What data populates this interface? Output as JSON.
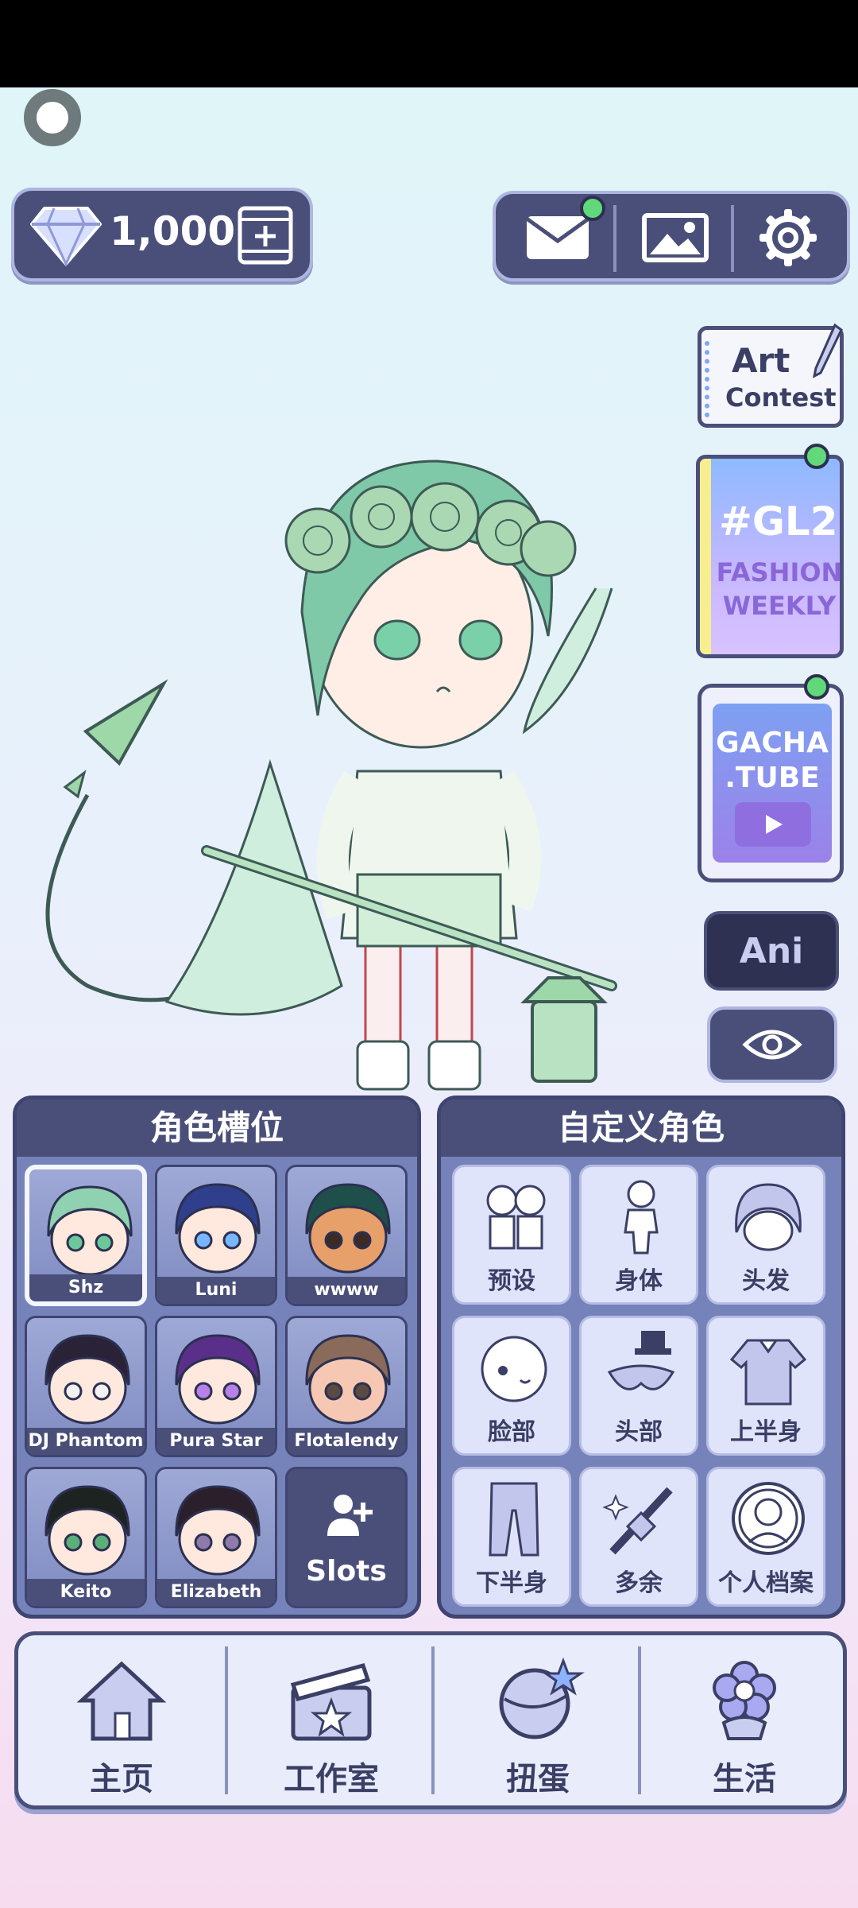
{
  "top": {
    "gem_count": "1,000"
  },
  "side": {
    "art_contest": {
      "line1": "Art",
      "line2": "Contest"
    },
    "gl2": {
      "title": "#GL2",
      "line1": "FASHION",
      "line2": "WEEKLY"
    },
    "gacha_tube": {
      "line1": "GACHA",
      "line2": ".TUBE"
    },
    "ani_label": "Ani"
  },
  "slots_panel": {
    "title": "角色槽位",
    "slots": [
      {
        "name": "Shz",
        "hair": "#8fd1b0",
        "eye": "#6cc79a",
        "skin": "#ffe8de"
      },
      {
        "name": "Luni",
        "hair": "#2f3f8c",
        "eye": "#78b6ff",
        "skin": "#ffe8de"
      },
      {
        "name": "wwww",
        "hair": "#1f4f4a",
        "eye": "#3a2b24",
        "skin": "#e7a06a"
      },
      {
        "name": "DJ Phantom",
        "hair": "#2a2237",
        "eye": "#f2f2f2",
        "skin": "#ffe8de"
      },
      {
        "name": "Pura Star",
        "hair": "#5a2f8a",
        "eye": "#b681e8",
        "skin": "#ffe8de"
      },
      {
        "name": "Flotalendy",
        "hair": "#8a6a5a",
        "eye": "#5a4a42",
        "skin": "#f6c8b4"
      },
      {
        "name": "Keito",
        "hair": "#1d2321",
        "eye": "#5bb07a",
        "skin": "#ffe8de"
      },
      {
        "name": "Elizabeth",
        "hair": "#2a1f2a",
        "eye": "#8f7aaa",
        "skin": "#ffe8de"
      }
    ],
    "add_label": "Slots"
  },
  "custom_panel": {
    "title": "自定义角色",
    "items": [
      "预设",
      "身体",
      "头发",
      "脸部",
      "头部",
      "上半身",
      "下半身",
      "多余",
      "个人档案"
    ]
  },
  "nav": {
    "items": [
      "主页",
      "工作室",
      "扭蛋",
      "生活"
    ]
  },
  "colors": {
    "panel_dark": "#4a4f7a",
    "accent_green": "#61d97a"
  }
}
